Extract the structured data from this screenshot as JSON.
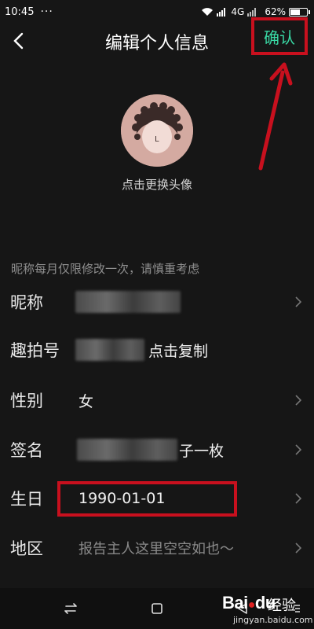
{
  "status_bar": {
    "time": "10:45",
    "network": "4G",
    "battery": "62%",
    "battery_level": 0.62
  },
  "header": {
    "title": "编辑个人信息",
    "confirm_label": "确认",
    "back_icon": "chevron-left-icon"
  },
  "avatar": {
    "caption": "点击更换头像"
  },
  "hint": "昵称每月仅限修改一次，请慎重考虑",
  "rows": [
    {
      "label": "昵称",
      "value": ""
    },
    {
      "label": "趣拍号",
      "value": "点击复制"
    },
    {
      "label": "性别",
      "value": "女"
    },
    {
      "label": "签名",
      "value": "子一枚"
    },
    {
      "label": "生日",
      "value": "1990-01-01"
    },
    {
      "label": "地区",
      "value": "报告主人这里空空如也～"
    }
  ],
  "watermark": {
    "logo": "Bai",
    "logo_suffix": "du",
    "text": "经验",
    "url": "jingyan.baidu.com"
  },
  "colors": {
    "background": "#161616",
    "accent": "#39d9a5",
    "annotation_red": "#c8101e"
  }
}
